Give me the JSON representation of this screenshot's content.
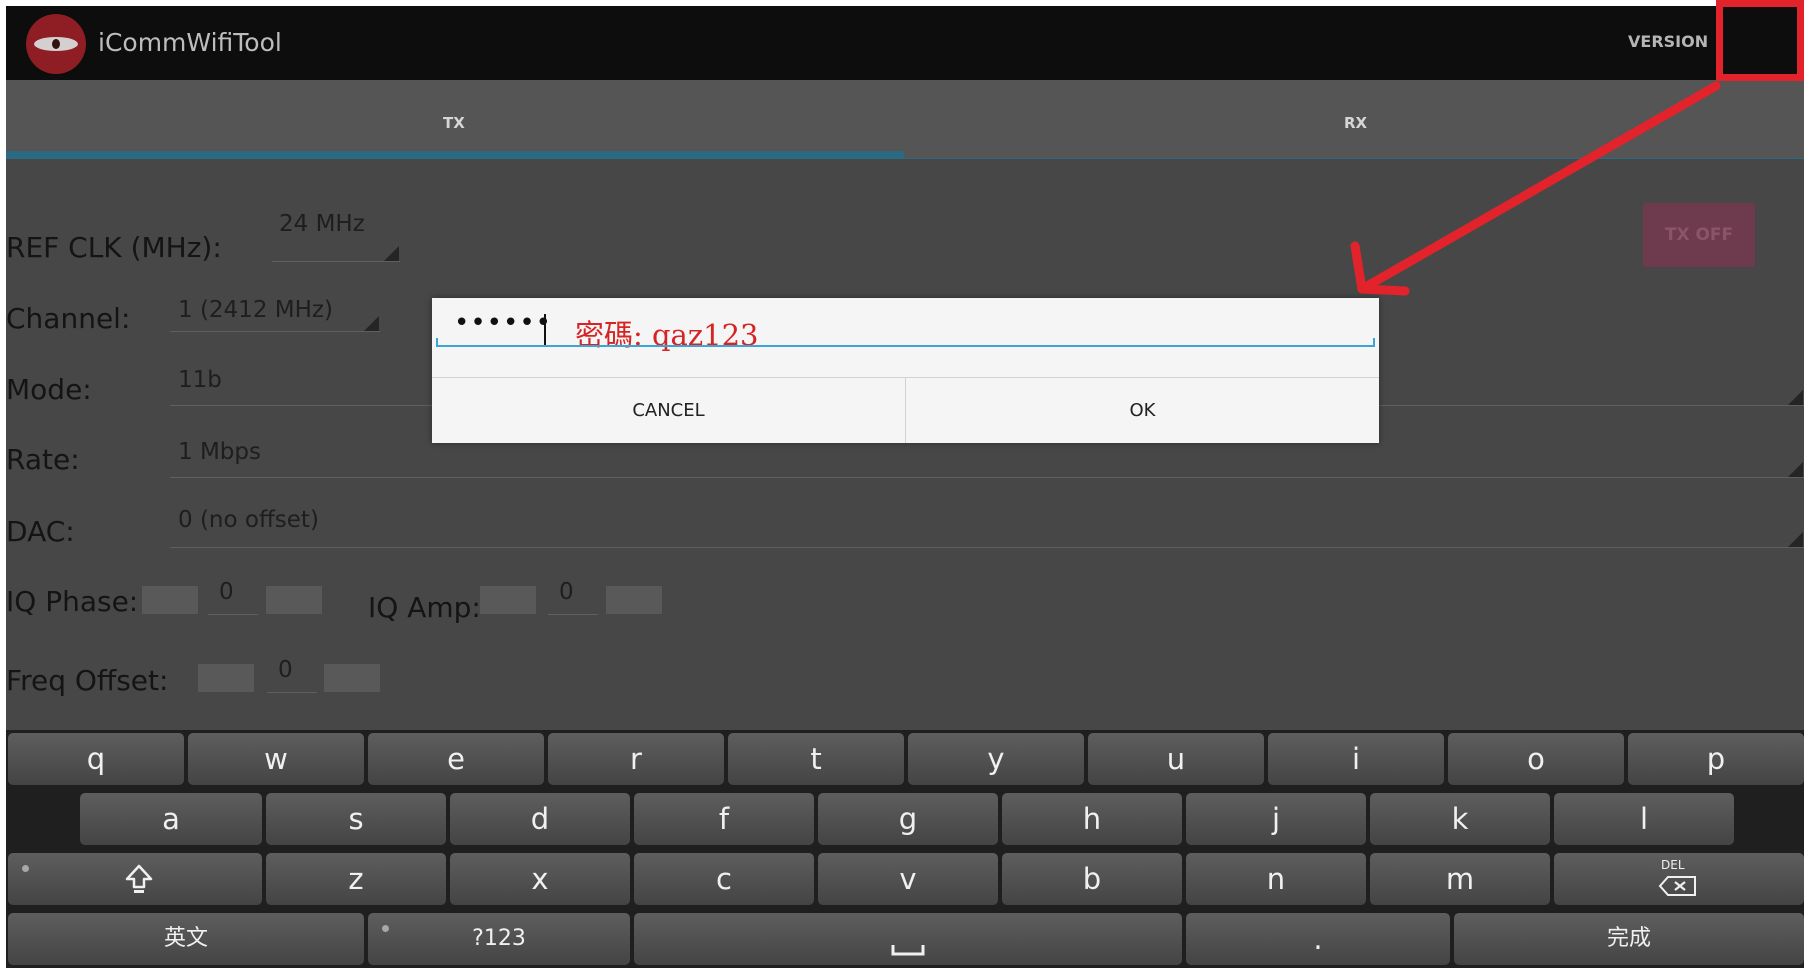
{
  "app": {
    "title": "iCommWifiTool",
    "menu_version": "VERSION"
  },
  "tabs": [
    {
      "label": "TX",
      "selected": true
    },
    {
      "label": "RX",
      "selected": false
    }
  ],
  "tx": {
    "ref_clk": {
      "label": "REF CLK (MHz):",
      "value": "24 MHz"
    },
    "channel": {
      "label": "Channel:",
      "value": "1 (2412 MHz)"
    },
    "mode": {
      "label": "Mode:",
      "value": "11b"
    },
    "rate": {
      "label": "Rate:",
      "value": "1 Mbps"
    },
    "dac": {
      "label": "DAC:",
      "value": "0 (no offset)"
    },
    "iq_phase": {
      "label": "IQ Phase:",
      "value": "0"
    },
    "iq_amp": {
      "label": "IQ Amp:",
      "value": "0"
    },
    "freq_offset": {
      "label": "Freq Offset:",
      "value": "0"
    },
    "tx_button": "TX OFF"
  },
  "dialog": {
    "password_value": "••••••",
    "hint": "密碼: qaz123",
    "cancel": "CANCEL",
    "ok": "OK"
  },
  "keyboard": {
    "row1": [
      "q",
      "w",
      "e",
      "r",
      "t",
      "y",
      "u",
      "i",
      "o",
      "p"
    ],
    "row2": [
      "a",
      "s",
      "d",
      "f",
      "g",
      "h",
      "j",
      "k",
      "l"
    ],
    "row3": [
      "z",
      "x",
      "c",
      "v",
      "b",
      "n",
      "m"
    ],
    "del_label": "DEL",
    "lang": "英文",
    "symbols": "?123",
    "period": ".",
    "done": "完成"
  },
  "colors": {
    "annotation": "#e3232b",
    "accent": "#2a6a82",
    "focus_line": "#3aa6d6"
  }
}
